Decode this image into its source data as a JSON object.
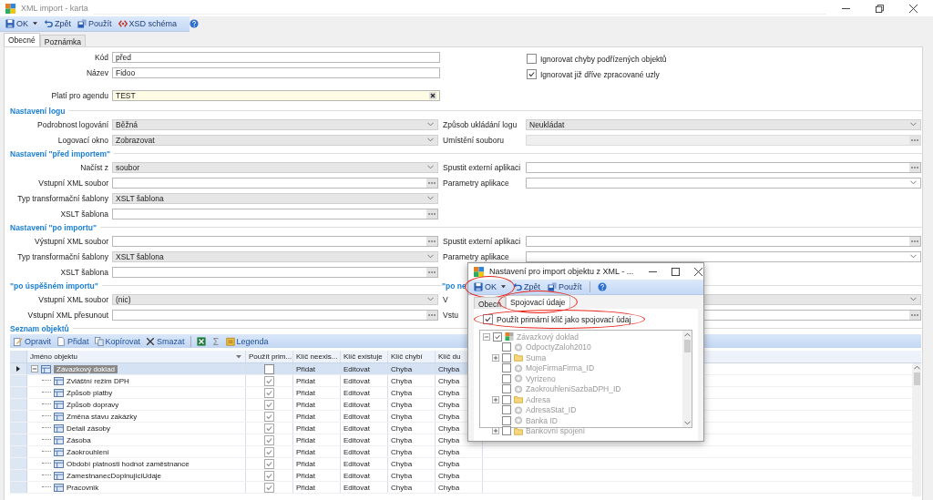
{
  "window": {
    "title": "XML import - karta"
  },
  "toolbar": [
    {
      "kind": "save",
      "label": "OK",
      "dropdown": true
    },
    {
      "kind": "undo",
      "label": "Zpět"
    },
    {
      "kind": "apply",
      "label": "Použít"
    },
    {
      "kind": "schema",
      "label": "XSD schéma"
    },
    {
      "kind": "help"
    }
  ],
  "tabs": [
    {
      "label": "Obecné",
      "selected": true
    },
    {
      "label": "Poznámka",
      "selected": false
    }
  ],
  "general": {
    "fields": [
      {
        "label": "Kód",
        "value": "před",
        "kind": "text"
      },
      {
        "label": "Název",
        "value": "Fidoo",
        "kind": "text"
      },
      {
        "label": "Platí pro agendu",
        "value": "TEST",
        "kind": "lookup"
      }
    ],
    "options": [
      {
        "label": "Ignorovat chyby podřízených objektů",
        "checked": false
      },
      {
        "label": "Ignorovat již dříve zpracované uzly",
        "checked": true
      }
    ]
  },
  "sections": [
    {
      "title": "Nastavení logu",
      "left": [
        {
          "label": "Podrobnost logování",
          "kind": "select",
          "value": "Běžná",
          "editable": false
        },
        {
          "label": "Logovací okno",
          "kind": "select",
          "value": "Zobrazovat",
          "editable": false
        }
      ],
      "right": [
        {
          "label": "Způsob ukládání logu",
          "kind": "select",
          "value": "Neukládat",
          "editable": false
        },
        {
          "label": "Umístění souboru",
          "kind": "file",
          "disabled": true
        }
      ]
    },
    {
      "title": "Nastavení \"před importem\"",
      "left": [
        {
          "label": "Načíst z",
          "kind": "select",
          "value": "soubor",
          "editable": false
        },
        {
          "label": "Vstupní XML soubor",
          "kind": "file",
          "disabled": false
        },
        {
          "label": "Typ transformační šablony",
          "kind": "select",
          "value": "XSLT šablona",
          "editable": false
        },
        {
          "label": "XSLT šablona",
          "kind": "file",
          "disabled": false
        }
      ],
      "right": [
        {
          "label": "Spustit externí aplikaci",
          "kind": "file",
          "disabled": false
        },
        {
          "label": "Parametry aplikace",
          "kind": "select",
          "editable": true
        }
      ]
    },
    {
      "title": "Nastavení \"po importu\"",
      "left": [
        {
          "label": "Výstupní XML soubor",
          "kind": "file",
          "disabled": false
        },
        {
          "label": "Typ transformační šablony",
          "kind": "select",
          "value": "XSLT šablona",
          "editable": false
        },
        {
          "label": "XSLT šablona",
          "kind": "file",
          "disabled": false
        }
      ],
      "right": [
        {
          "label": "Spustit externí aplikaci",
          "kind": "file",
          "disabled": false
        },
        {
          "label": "Parametry aplikace",
          "kind": "select",
          "editable": true
        }
      ]
    },
    {
      "title": "\"po úspěšném importu\"",
      "right_title": "\"po ne",
      "left": [
        {
          "label": "Vstupní XML soubor",
          "kind": "select",
          "value": "(nic)",
          "editable": false
        },
        {
          "label": "Vstupní XML přesunout",
          "kind": "file",
          "disabled": false
        }
      ],
      "right": [
        {
          "label": "V",
          "kind": "select",
          "editable": false
        },
        {
          "label": "Vstu",
          "kind": "file",
          "disabled": false
        }
      ]
    }
  ],
  "objects": {
    "title": "Seznam objektů",
    "toolbar": [
      {
        "kind": "edit",
        "label": "Opravit"
      },
      {
        "kind": "add",
        "label": "Přidat"
      },
      {
        "kind": "copy",
        "label": "Kopírovat"
      },
      {
        "kind": "delete",
        "label": "Smazat"
      },
      {
        "kind": "excel"
      },
      {
        "kind": "sum"
      },
      {
        "kind": "legend",
        "label": "Legenda"
      }
    ],
    "columns": [
      "Jméno objektu",
      "Použít prim...",
      "Klíč neexis...",
      "Klíč existuje",
      "Klíč chybí",
      "Klíč du"
    ],
    "rows": [
      {
        "name": "Závazkový doklad",
        "selected": true,
        "expanded": true,
        "use_primary": false,
        "key_missing": "Přidat",
        "key_exists": "Editovat",
        "key_absent": "Chyba",
        "key_duplicate": "Chyba",
        "children": [
          {
            "name": "Zvláštní režim DPH",
            "selected": false,
            "use_primary": true,
            "key_missing": "Přidat",
            "key_exists": "Editovat",
            "key_absent": "Chyba",
            "key_duplicate": "Chyba"
          },
          {
            "name": "Způsob platby",
            "selected": false,
            "use_primary": true,
            "key_missing": "Přidat",
            "key_exists": "Editovat",
            "key_absent": "Chyba",
            "key_duplicate": "Chyba"
          },
          {
            "name": "Způsob dopravy",
            "selected": false,
            "use_primary": true,
            "key_missing": "Přidat",
            "key_exists": "Editovat",
            "key_absent": "Chyba",
            "key_duplicate": "Chyba"
          },
          {
            "name": "Změna stavu zakázky",
            "selected": false,
            "use_primary": true,
            "key_missing": "Přidat",
            "key_exists": "Editovat",
            "key_absent": "Chyba",
            "key_duplicate": "Chyba"
          },
          {
            "name": "Detail zásoby",
            "selected": false,
            "use_primary": true,
            "key_missing": "Přidat",
            "key_exists": "Editovat",
            "key_absent": "Chyba",
            "key_duplicate": "Chyba"
          },
          {
            "name": "Zásoba",
            "selected": false,
            "use_primary": true,
            "key_missing": "Přidat",
            "key_exists": "Editovat",
            "key_absent": "Chyba",
            "key_duplicate": "Chyba"
          },
          {
            "name": "Zaokrouhlení",
            "selected": false,
            "use_primary": true,
            "key_missing": "Přidat",
            "key_exists": "Editovat",
            "key_absent": "Chyba",
            "key_duplicate": "Chyba"
          },
          {
            "name": "Období platnosti hodnot zaměstnance",
            "selected": false,
            "use_primary": true,
            "key_missing": "Přidat",
            "key_exists": "Editovat",
            "key_absent": "Chyba",
            "key_duplicate": "Chyba"
          },
          {
            "name": "ZamestnanecDoplnujiciUdaje",
            "selected": false,
            "use_primary": true,
            "key_missing": "Přidat",
            "key_exists": "Editovat",
            "key_absent": "Chyba",
            "key_duplicate": "Chyba"
          },
          {
            "name": "Pracovnik",
            "selected": false,
            "use_primary": true,
            "key_missing": "Přidat",
            "key_exists": "Editovat",
            "key_absent": "Chyba",
            "key_duplicate": "Chyba"
          }
        ]
      }
    ]
  },
  "dialog": {
    "title": "Nastavení pro import objektu z XML - ...",
    "toolbar": [
      {
        "kind": "save",
        "label": "OK",
        "dropdown": true,
        "circled": true
      },
      {
        "kind": "undo",
        "label": "Zpět"
      },
      {
        "kind": "apply",
        "label": "Použít"
      },
      {
        "kind": "help"
      }
    ],
    "tabs": [
      {
        "label": "Obecn",
        "selected": false
      },
      {
        "label": "Spojovací údaje",
        "selected": true,
        "circled": true
      }
    ],
    "option": {
      "label": "Použít primární klíč jako spojovací údaj",
      "checked": true,
      "circled": true
    },
    "tree_disabled": true,
    "tree": [
      {
        "label": "Závazkový doklad",
        "kind": "entity",
        "checked": true,
        "expanded": true,
        "children": [
          {
            "label": "OdpoctyZaloh2010",
            "kind": "field",
            "checked": false
          },
          {
            "label": "Suma",
            "kind": "folder",
            "checked": false,
            "expanded": false
          },
          {
            "label": "MojeFirmaFirma_ID",
            "kind": "field",
            "checked": false
          },
          {
            "label": "Vyrizeno",
            "kind": "field",
            "checked": false
          },
          {
            "label": "ZaokrouhleniSazbaDPH_ID",
            "kind": "field",
            "checked": false
          },
          {
            "label": "Adresa",
            "kind": "folder",
            "checked": false,
            "expanded": false
          },
          {
            "label": "AdresaStat_ID",
            "kind": "field",
            "checked": false
          },
          {
            "label": "Banka ID",
            "kind": "field",
            "checked": false
          },
          {
            "label": "Bankovní spojení",
            "kind": "folder",
            "checked": false,
            "expanded": false
          }
        ]
      }
    ]
  }
}
